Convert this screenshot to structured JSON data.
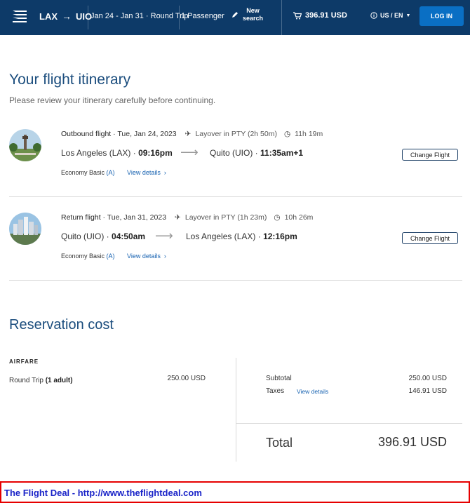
{
  "header": {
    "origin": "LAX",
    "destination": "UIO",
    "dates": "Jan 24 - Jan 31",
    "trip_type": "Round Trip",
    "passengers": "1 Passenger",
    "new_search_line1": "New",
    "new_search_line2": "search",
    "cart_total": "396.91 USD",
    "locale": "US / EN",
    "login_label": "LOG IN"
  },
  "itinerary": {
    "title": "Your flight itinerary",
    "subtitle": "Please review your itinerary carefully before continuing.",
    "flights": [
      {
        "label": "Outbound flight",
        "date": "Tue, Jan 24, 2023",
        "layover": "Layover in PTY (2h 50m)",
        "duration": "11h 19m",
        "from_city": "Los Angeles (LAX)",
        "dep_time": "09:16pm",
        "to_city": "Quito (UIO)",
        "arr_time": "11:35am+1",
        "fare_class": "Economy Basic",
        "fare_code": "(A)",
        "details_link": "View details",
        "change_label": "Change Flight"
      },
      {
        "label": "Return flight",
        "date": "Tue, Jan 31, 2023",
        "layover": "Layover in PTY (1h 23m)",
        "duration": "10h 26m",
        "from_city": "Quito (UIO)",
        "dep_time": "04:50am",
        "to_city": "Los Angeles (LAX)",
        "arr_time": "12:16pm",
        "fare_class": "Economy Basic",
        "fare_code": "(A)",
        "details_link": "View details",
        "change_label": "Change Flight"
      }
    ]
  },
  "cost": {
    "title": "Reservation cost",
    "airfare_heading": "AIRFARE",
    "fare_label": "Round Trip",
    "fare_pax": "(1 adult)",
    "fare_amount": "250.00 USD",
    "subtotal_label": "Subtotal",
    "subtotal_amount": "250.00 USD",
    "taxes_label": "Taxes",
    "taxes_link": "View details",
    "taxes_amount": "146.91 USD",
    "total_label": "Total",
    "total_amount": "396.91 USD"
  },
  "banner": {
    "text": "The Flight Deal - http://www.theflightdeal.com"
  },
  "colors": {
    "header_bg": "#0d3a68",
    "login_bg": "#0a6fc4",
    "heading": "#1c4e7e",
    "link": "#1460b0",
    "banner_border": "#e60000",
    "banner_text": "#1a24c8"
  }
}
